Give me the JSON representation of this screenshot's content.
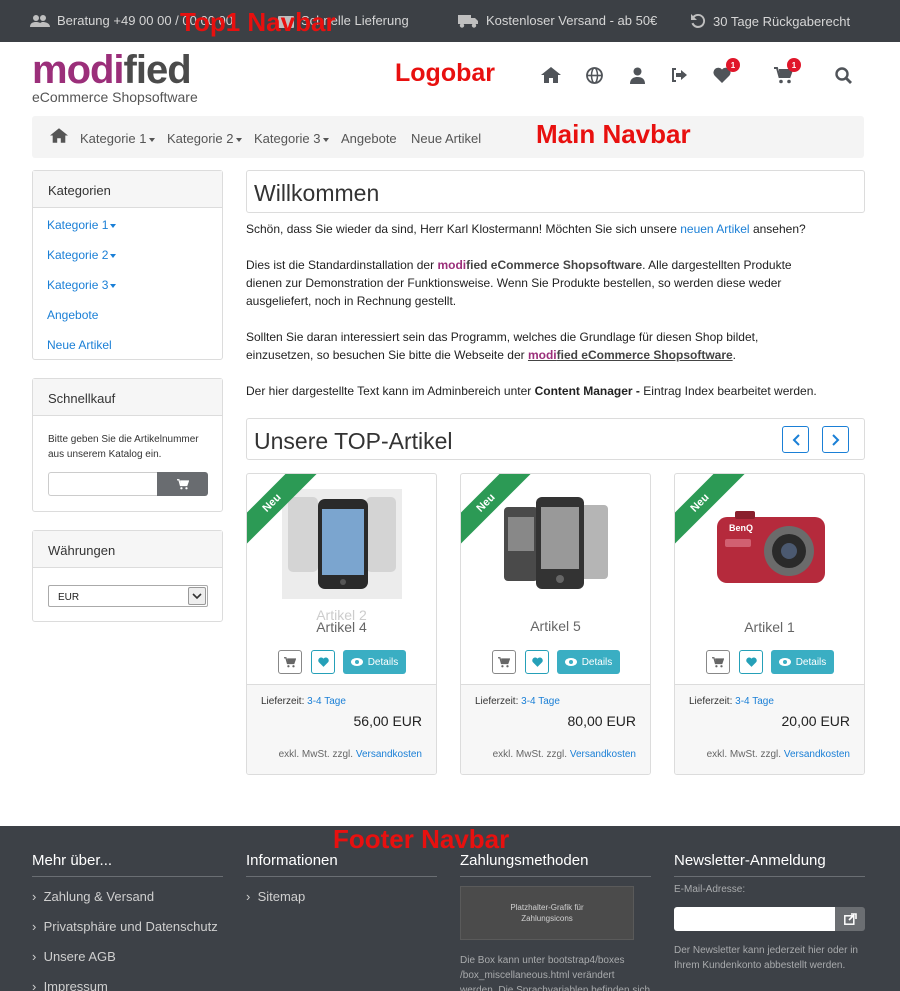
{
  "annotations": {
    "top1": "Top1 Navbar",
    "logobar": "Logobar",
    "main_navbar": "Main Navbar",
    "footer_navbar": "Footer Navbar"
  },
  "topbar": {
    "items": [
      {
        "icon": "users-icon",
        "label": "Beratung +49 00 00 / 00 00 00"
      },
      {
        "icon": "box-icon",
        "label": "Schnelle Lieferung"
      },
      {
        "icon": "truck-icon",
        "label": "Kostenloser Versand - ab 50€"
      },
      {
        "icon": "undo-icon",
        "label": "30 Tage Rückgaberecht"
      }
    ]
  },
  "logo": {
    "part1": "modi",
    "part2": "fied",
    "subtitle": "eCommerce Shopsoftware"
  },
  "header_icons": {
    "wishlist_count": "1",
    "cart_count": "1"
  },
  "mainnav": {
    "items": [
      "Kategorie 1",
      "Kategorie 2",
      "Kategorie 3",
      "Angebote",
      "Neue Artikel"
    ]
  },
  "sidebar": {
    "categories_title": "Kategorien",
    "categories": [
      "Kategorie 1",
      "Kategorie 2",
      "Kategorie 3",
      "Angebote",
      "Neue Artikel"
    ],
    "quickbuy_title": "Schnellkauf",
    "quickbuy_text_1": "Bitte geben Sie die Artikelnummer",
    "quickbuy_text_2": "aus unserem Katalog ein.",
    "quickbuy_value": "",
    "currency_title": "Währungen",
    "currency_selected": "EUR"
  },
  "content": {
    "welcome_title": "Willkommen",
    "p1_a": "Schön, dass Sie wieder da sind, Herr Karl Klostermann! Möchten Sie sich unsere ",
    "p1_link": "neuen Artikel",
    "p1_b": " ansehen?",
    "p2_a": "Dies ist die Standardinstallation der ",
    "p2_brand_1": "modi",
    "p2_brand_2": "fied eCommerce Shopsoftware",
    "p2_b": ". Alle dargestellten Produkte",
    "p2_line2": "dienen zur Demonstration der Funktionsweise. Wenn Sie Produkte bestellen, so werden diese weder",
    "p2_line3": "ausgeliefert, noch in Rechnung gestellt.",
    "p3_line1": "Sollten Sie daran interessiert sein das Programm, welches die Grundlage für diesen Shop bildet,",
    "p3_a": "einzusetzen, so besuchen Sie bitte die Webseite der ",
    "p3_brand_1": "modi",
    "p3_brand_2": "fied eCommerce Shopsoftware",
    "p3_b": ".",
    "p4_a": "Der hier dargestellte Text kann im Adminbereich unter ",
    "p4_bold": "Content Manager -",
    "p4_b": " Eintrag Index bearbeitet werden.",
    "top_title": "Unsere TOP-Artikel"
  },
  "products": [
    {
      "ribbon": "Neu",
      "ghost_name": "Artikel 2",
      "name": "Artikel 4",
      "delivery_label": "Lieferzeit:",
      "delivery": "3-4 Tage",
      "price": "56,00 EUR",
      "tax_text": "exkl. MwSt. zzgl.",
      "shipping_link": "Versandkosten",
      "details": "Details"
    },
    {
      "ribbon": "Neu",
      "name": "Artikel 5",
      "delivery_label": "Lieferzeit:",
      "delivery": "3-4 Tage",
      "price": "80,00 EUR",
      "tax_text": "exkl. MwSt. zzgl.",
      "shipping_link": "Versandkosten",
      "details": "Details"
    },
    {
      "ribbon": "Neu",
      "name": "Artikel 1",
      "delivery_label": "Lieferzeit:",
      "delivery": "3-4 Tage",
      "price": "20,00 EUR",
      "tax_text": "exkl. MwSt. zzgl.",
      "shipping_link": "Versandkosten",
      "details": "Details",
      "camera_brand": "BenQ"
    }
  ],
  "footer": {
    "col1_title": "Mehr über...",
    "col1_links": [
      "Zahlung & Versand",
      "Privatsphäre und Datenschutz",
      "Unsere AGB",
      "Impressum"
    ],
    "col2_title": "Informationen",
    "col2_links": [
      "Sitemap"
    ],
    "col3_title": "Zahlungsmethoden",
    "col3_placeholder_1": "Platzhalter-Grafik für",
    "col3_placeholder_2": "Zahlungsicons",
    "col3_text_1": "Die Box kann unter bootstrap4/boxes",
    "col3_text_2": "/box_miscellaneous.html verändert",
    "col3_text_3": "werden. Die Sprachvariablen befinden sich",
    "col4_title": "Newsletter-Anmeldung",
    "col4_label": "E-Mail-Adresse:",
    "col4_value": "",
    "col4_text_1": "Der Newsletter kann jederzeit hier oder in",
    "col4_text_2": "Ihrem Kundenkonto abbestellt werden."
  },
  "colors": {
    "brand": "#9b2f7a",
    "link": "#1a7fd6",
    "ribbon": "#2c9a55",
    "details_button": "#3aaec3",
    "footer_bg": "#3d4147",
    "topbar_bg": "#3c4045",
    "badge": "#e0162a"
  }
}
